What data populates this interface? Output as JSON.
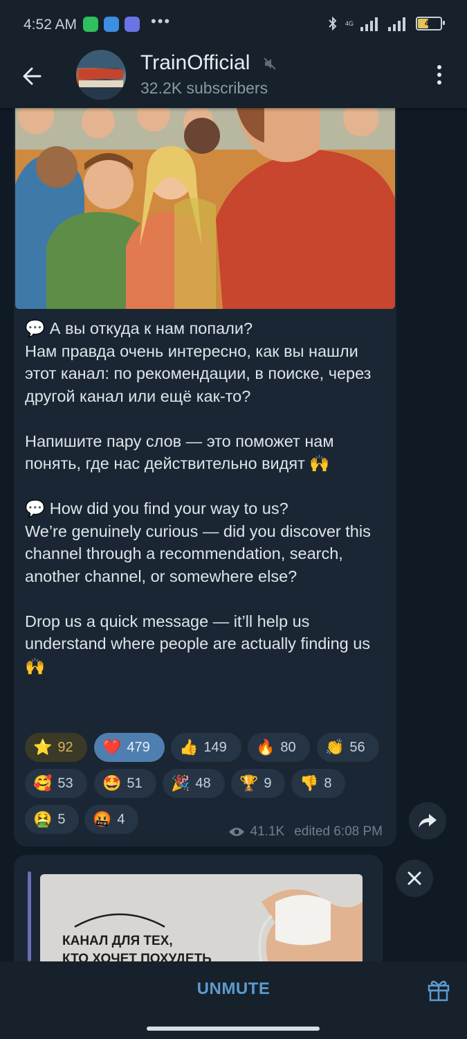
{
  "status_bar": {
    "time": "4:52 AM",
    "network": "4G",
    "battery": "44",
    "battery_level": 0.44
  },
  "header": {
    "title": "TrainOfficial",
    "subscribers": "32.2K subscribers"
  },
  "message": {
    "text": "💬 А вы откуда к нам попали?\nНам правда очень интересно, как вы нашли этот канал: по рекомендации, в поиске, через другой канал или ещё как-то?\n\nНапишите пару слов — это поможет нам понять, где нас действительно видят 🙌\n\n💬 How did you find your way to us?\nWe’re genuinely curious — did you discover this channel through a recommendation, search, another channel, or somewhere else?\n\nDrop us a quick message — it’ll help us understand where people are actually finding us 🙌",
    "reactions": [
      {
        "emoji": "⭐",
        "count": "92"
      },
      {
        "emoji": "❤️",
        "count": "479"
      },
      {
        "emoji": "👍",
        "count": "149"
      },
      {
        "emoji": "🔥",
        "count": "80"
      },
      {
        "emoji": "👏",
        "count": "56"
      },
      {
        "emoji": "🥰",
        "count": "53"
      },
      {
        "emoji": "🤩",
        "count": "51"
      },
      {
        "emoji": "🎉",
        "count": "48"
      },
      {
        "emoji": "🏆",
        "count": "9"
      },
      {
        "emoji": "👎",
        "count": "8"
      },
      {
        "emoji": "🤮",
        "count": "5"
      },
      {
        "emoji": "🤬",
        "count": "4"
      }
    ],
    "views": "41.1K",
    "edited": "edited 6:08 PM"
  },
  "sponsored": {
    "image_text": "КАНАЛ ДЛЯ ТЕХ,\nКТО ХОЧЕТ ПОХУДЕТЬ"
  },
  "bottom_bar": {
    "unmute_label": "UNMUTE"
  },
  "colors": {
    "accent": "#5c9bd1",
    "bubble": "#1a2633",
    "header": "#17212b"
  }
}
